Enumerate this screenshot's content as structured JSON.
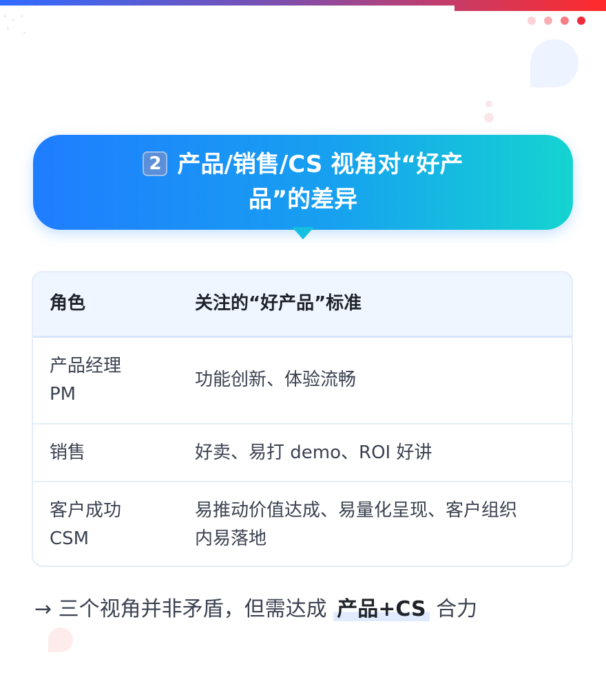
{
  "colors": {
    "banner_start": "#1f7dff",
    "banner_end": "#14d4d0",
    "header_bg": "#f0f6ff",
    "dot_colors": [
      "#fbd2d6",
      "#f9b0b6",
      "#f57d86",
      "#ee2b3a"
    ]
  },
  "banner": {
    "number": "2",
    "title_line1": "产品/销售/CS 视角对“好产",
    "title_line2": "品”的差异"
  },
  "table": {
    "headers": [
      "角色",
      "关注的“好产品”标准"
    ],
    "rows": [
      {
        "role_line1": "产品经理",
        "role_line2": "PM",
        "standard_line1": "功能创新、体验流畅",
        "standard_line2": ""
      },
      {
        "role_line1": "销售",
        "role_line2": "",
        "standard_line1": "好卖、易打 demo、ROI 好讲",
        "standard_line2": ""
      },
      {
        "role_line1": "客户成功",
        "role_line2": "CSM",
        "standard_line1": "易推动价值达成、易量化呈现、客户组织",
        "standard_line2": "内易落地"
      }
    ]
  },
  "footer": {
    "prefix": "→ 三个视角并非矛盾，但需达成",
    "highlight": "产品+CS",
    "suffix": "合力"
  }
}
